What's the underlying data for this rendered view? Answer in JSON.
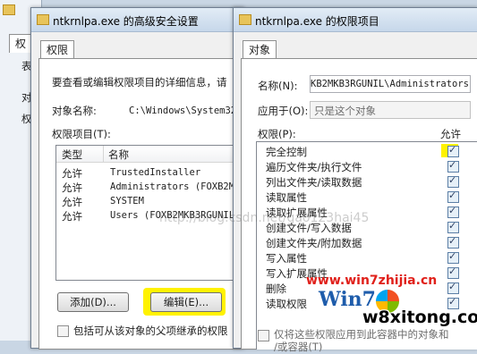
{
  "explorer": {
    "tab_label": "权",
    "side_chars": [
      "表",
      "对",
      "权"
    ]
  },
  "advanced_dialog": {
    "title": "ntkrnlpa.exe 的高级安全设置",
    "tab": "权限",
    "intro": "要查看或编辑权限项目的详细信息，请",
    "object_name_label": "对象名称:",
    "object_name_value": "C:\\Windows\\System32",
    "entries_label": "权限项目(T):",
    "columns": [
      "类型",
      "名称"
    ],
    "rows": [
      {
        "type": "允许",
        "name": "TrustedInstaller"
      },
      {
        "type": "允许",
        "name": "Administrators (FOXB2M"
      },
      {
        "type": "允许",
        "name": "SYSTEM"
      },
      {
        "type": "允许",
        "name": "Users (FOXB2MKB3RGUNIL"
      }
    ],
    "add_button": "添加(D)...",
    "edit_button": "编辑(E)...",
    "inherit_checkbox": "包括可从该对象的父项继承的权限"
  },
  "perm_dialog": {
    "title": "ntkrnlpa.exe 的权限项目",
    "tab": "对象",
    "name_label": "名称(N):",
    "name_value": "KB2MKB3RGUNIL\\Administrators)",
    "apply_label": "应用于(O):",
    "apply_value": "只是这个对象",
    "permissions_label": "权限(P):",
    "allow_header": "允许",
    "permissions": [
      {
        "label": "完全控制",
        "checked": true,
        "highlight": true
      },
      {
        "label": "遍历文件夹/执行文件",
        "checked": true
      },
      {
        "label": "列出文件夹/读取数据",
        "checked": true
      },
      {
        "label": "读取属性",
        "checked": true
      },
      {
        "label": "读取扩展属性",
        "checked": true
      },
      {
        "label": "创建文件/写入数据",
        "checked": true
      },
      {
        "label": "创建文件夹/附加数据",
        "checked": true
      },
      {
        "label": "写入属性",
        "checked": true
      },
      {
        "label": "写入扩展属性",
        "checked": true
      },
      {
        "label": "删除",
        "checked": true
      },
      {
        "label": "读取权限",
        "checked": true
      }
    ],
    "bottom_checkbox_line1": "仅将这些权限应用到此容器中的对象和",
    "bottom_checkbox_line2": "/或容器(T)"
  },
  "watermarks": {
    "blog": "http://blog.csdn.net/gao123hai45",
    "site1": "www.win7zhijia.cn",
    "site2": "w8xitong.com",
    "logo": "Win7"
  },
  "colors": {
    "highlight": "#fff200",
    "site_red": "#e0201a"
  }
}
